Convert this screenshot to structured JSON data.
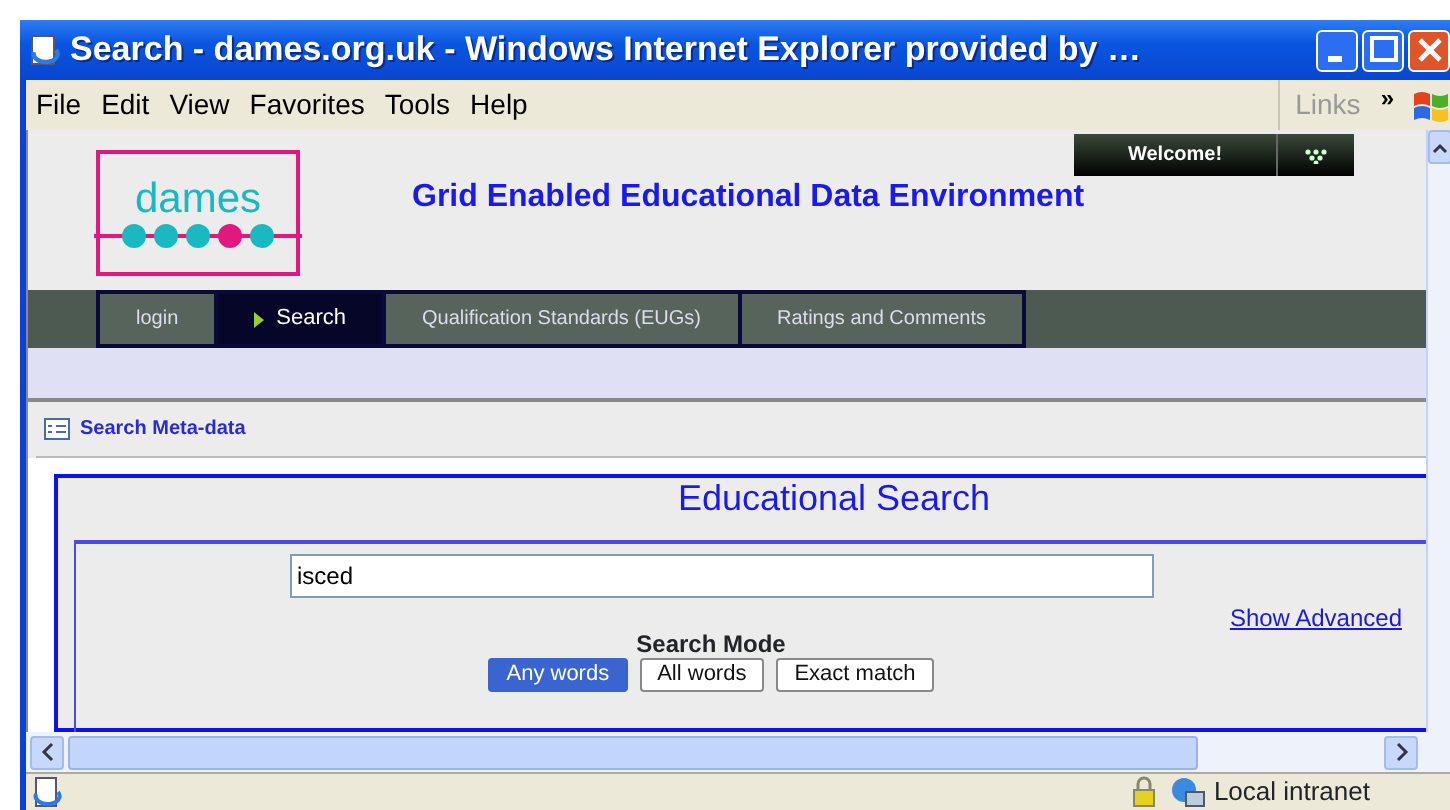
{
  "window": {
    "title": "Search - dames.org.uk - Windows Internet Explorer provided by …"
  },
  "menu": [
    {
      "label": "File"
    },
    {
      "label": "Edit"
    },
    {
      "label": "View"
    },
    {
      "label": "Favorites"
    },
    {
      "label": "Tools"
    },
    {
      "label": "Help"
    }
  ],
  "links_bar": {
    "label": "Links",
    "more": "»"
  },
  "header": {
    "logo": "dames",
    "logo_dots": [
      {
        "color": "#1ab8c0"
      },
      {
        "color": "#1ab8c0"
      },
      {
        "color": "#1ab8c0"
      },
      {
        "color": "#e0187f"
      },
      {
        "color": "#1ab8c0"
      }
    ],
    "site_title": "Grid Enabled Educational Data Environment",
    "welcome": "Welcome!"
  },
  "nav": [
    {
      "label": "login",
      "selected": false
    },
    {
      "label": "Search",
      "selected": true
    },
    {
      "label": "Qualification Standards (EUGs)",
      "selected": false
    },
    {
      "label": "Ratings and Comments",
      "selected": false
    }
  ],
  "panel": {
    "title": "Search Meta-data"
  },
  "search": {
    "heading": "Educational Search",
    "value": "isced",
    "advanced_link": "Show Advanced",
    "mode_label": "Search Mode",
    "modes": [
      {
        "label": "Any words",
        "selected": true
      },
      {
        "label": "All words",
        "selected": false
      },
      {
        "label": "Exact match",
        "selected": false
      }
    ]
  },
  "status_bar": {
    "zone": "Local intranet"
  }
}
